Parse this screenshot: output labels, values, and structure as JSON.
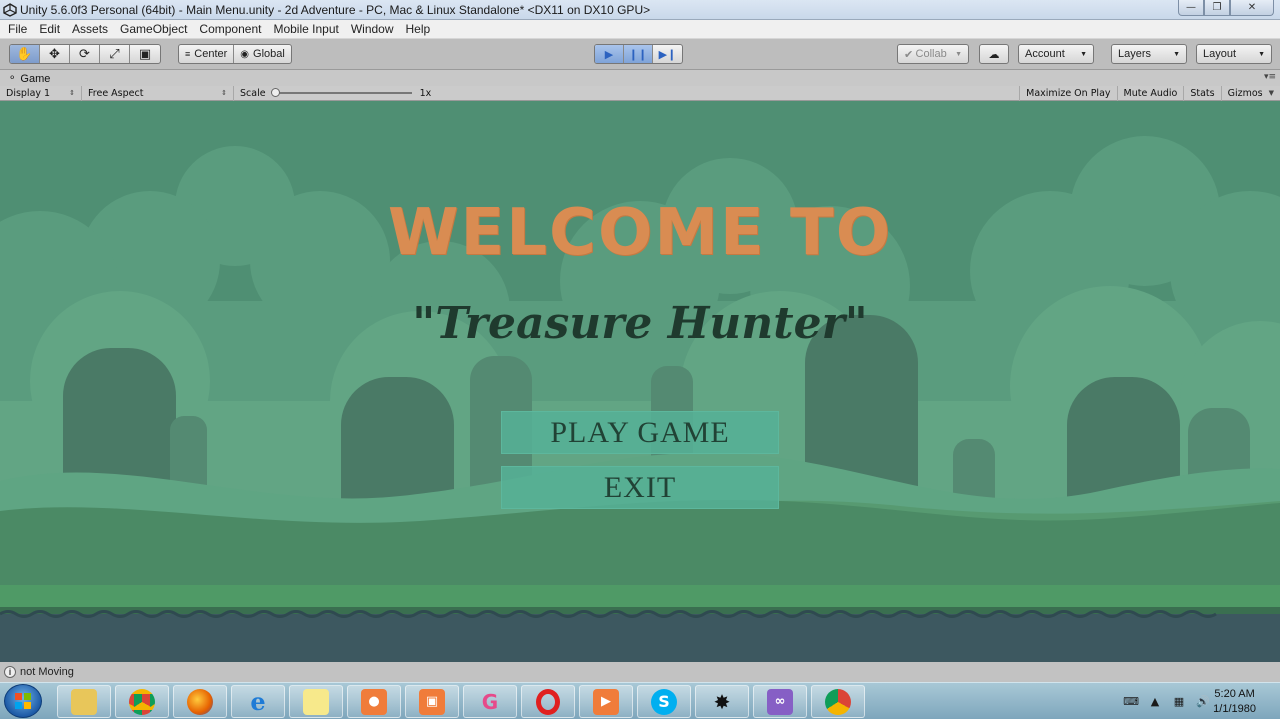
{
  "window": {
    "title": "Unity 5.6.0f3 Personal (64bit) - Main Menu.unity - 2d Adventure - PC, Mac & Linux Standalone* <DX11 on DX10 GPU>",
    "controls": [
      "minimize-icon",
      "restore-icon",
      "close-icon"
    ]
  },
  "menu": {
    "items": [
      "File",
      "Edit",
      "Assets",
      "GameObject",
      "Component",
      "Mobile Input",
      "Window",
      "Help"
    ]
  },
  "toolbar": {
    "tools": [
      "hand-icon",
      "move-icon",
      "rotate-icon",
      "scale-icon",
      "rect-tool-icon"
    ],
    "pivot_label": "Center",
    "space_label": "Global",
    "playback": [
      "play-icon",
      "pause-icon",
      "step-icon"
    ],
    "collab_label": "Collab",
    "account_label": "Account",
    "layers_label": "Layers",
    "layout_label": "Layout"
  },
  "game_tab": {
    "label": "Game",
    "display": "Display 1",
    "aspect": "Free Aspect",
    "scale_label": "Scale",
    "scale_value": "1x",
    "maximize": "Maximize On Play",
    "mute": "Mute Audio",
    "stats": "Stats",
    "gizmos": "Gizmos"
  },
  "game": {
    "welcome": "WELCOME TO",
    "title": "\"Treasure Hunter\"",
    "play_button": "PLAY GAME",
    "exit_button": "EXIT"
  },
  "status": {
    "message": "not Moving"
  },
  "taskbar": {
    "time": "5:20 AM",
    "date": "1/1/1980"
  },
  "colors": {
    "sky": "#4e8e72",
    "welcome_text": "#d98c52",
    "title_text": "#1f3a2e",
    "button_fill": "#56b096"
  }
}
